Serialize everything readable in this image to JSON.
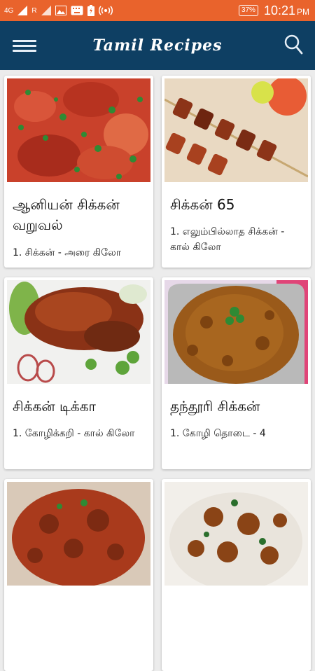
{
  "status": {
    "network": "4G",
    "sim1": "1",
    "roaming": "R",
    "sim2": "1|2",
    "battery": "37%",
    "time": "10:21",
    "ampm": "PM"
  },
  "app": {
    "title": "Tamil Recipes"
  },
  "recipes": [
    {
      "name": "ஆனியன் சிக்கன் வறுவல்",
      "ingredient": "1. சிக்கன்  - அரை கிலோ"
    },
    {
      "name": "சிக்கன் 65",
      "ingredient": "1. எலும்பில்லாத சிக்கன் - கால் கிலோ"
    },
    {
      "name": "சிக்கன் டிக்கா",
      "ingredient": "1. கோழிக்கறி  - கால் கிலோ"
    },
    {
      "name": "தந்தூரி சிக்கன்",
      "ingredient": "1. கோழி தொடை -  4"
    },
    {
      "name": "",
      "ingredient": ""
    },
    {
      "name": "",
      "ingredient": ""
    }
  ]
}
